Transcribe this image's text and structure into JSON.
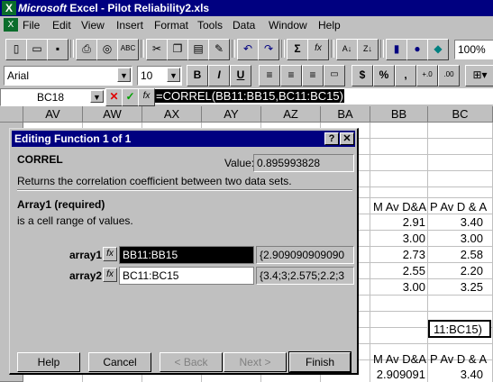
{
  "title": {
    "app": "Microsoft",
    "rest": "Excel - Pilot Reliability2.xls"
  },
  "menu": [
    "File",
    "Edit",
    "View",
    "Insert",
    "Format",
    "Tools",
    "Data",
    "Window",
    "Help"
  ],
  "standard_toolbar": {
    "zoom": "100%"
  },
  "format_toolbar": {
    "font": "Arial",
    "size": "10",
    "bold": "B",
    "italic": "I",
    "underline": "U",
    "currency": "$",
    "percent": "%",
    "comma": ","
  },
  "formula_bar": {
    "name_box": "BC18",
    "cancel": "✕",
    "enter": "✓",
    "fx": "fx",
    "formula": "=CORREL(BB11:BB15,BC11:BC15)"
  },
  "grid": {
    "columns": [
      "AV",
      "AW",
      "AX",
      "AY",
      "AZ",
      "BA",
      "BB",
      "BC"
    ],
    "bb_header1": "M Av D&A",
    "bc_header1": "P Av D & A",
    "bb_values": [
      "2.91",
      "3.00",
      "2.73",
      "2.55",
      "3.00"
    ],
    "bc_values": [
      "3.40",
      "3.00",
      "2.58",
      "2.20",
      "3.25"
    ],
    "bc18_edit": "11:BC15)",
    "bb_header2": "M Av D&A",
    "bc_header2": "P Av D & A",
    "bb_last": "2.909091",
    "bc_last": "3.40"
  },
  "dialog": {
    "title": "Editing Function 1 of 1",
    "help_btn": "?",
    "close_btn": "✕",
    "function_name": "CORREL",
    "value_label": "Value:",
    "value": "0.895993828",
    "description": "Returns the correlation coefficient between two data sets.",
    "arg_title": "Array1 (required)",
    "arg_desc": "is a cell range of values.",
    "array1_label": "array1",
    "array1_value": "BB11:BB15",
    "array1_result": "{2.909090909090",
    "array2_label": "array2",
    "array2_value": "BC11:BC15",
    "array2_result": "{3.4;3;2.575;2.2;3",
    "buttons": {
      "help": "Help",
      "cancel": "Cancel",
      "back": "< Back",
      "next": "Next >",
      "finish": "Finish"
    }
  }
}
